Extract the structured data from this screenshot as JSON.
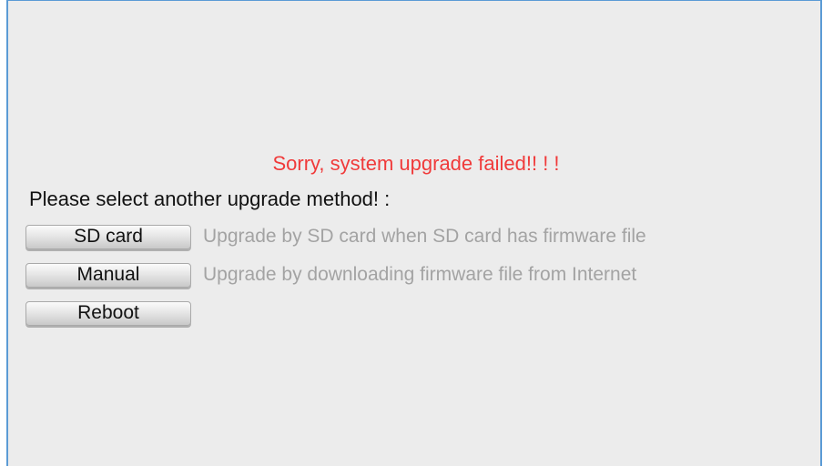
{
  "error_message": "Sorry, system upgrade failed!! ! !",
  "prompt": "Please select another upgrade method! :",
  "options": [
    {
      "button_label": "SD card",
      "description": "Upgrade by SD card when SD card has firmware file"
    },
    {
      "button_label": "Manual",
      "description": "Upgrade by downloading firmware file from Internet"
    },
    {
      "button_label": "Reboot",
      "description": ""
    }
  ],
  "colors": {
    "background": "#ececec",
    "error_text": "#f03a3a",
    "description_text": "#a3a3a3",
    "frame_border": "#5b9bd5"
  }
}
